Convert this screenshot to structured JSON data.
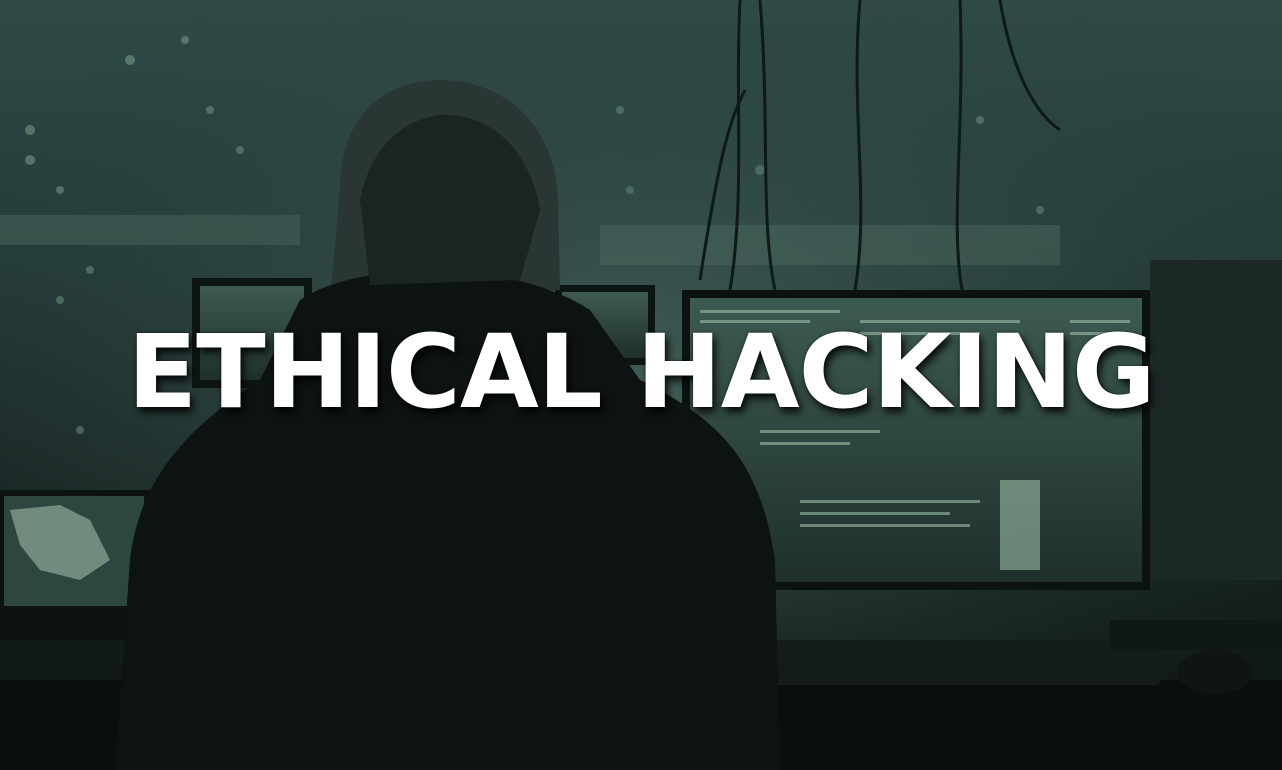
{
  "title": "ETHICAL HACKING",
  "image": {
    "subject": "hooded-person-at-computer-monitors",
    "palette": {
      "background": "#2f4a47",
      "shadow": "#0c1211",
      "screen_glow": "#7fa88f",
      "text": "#ffffff"
    }
  }
}
